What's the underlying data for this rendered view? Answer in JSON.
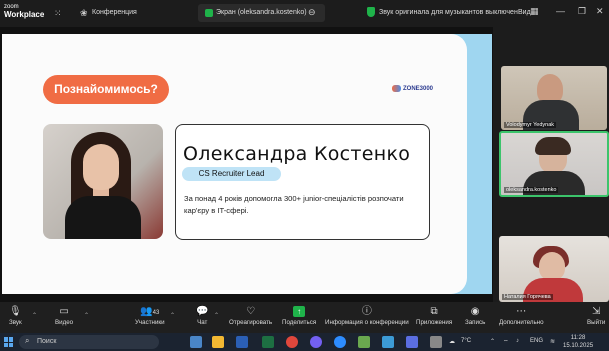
{
  "app": {
    "logo_line1": "zoom",
    "logo_line2": "Workplace"
  },
  "topbar": {
    "conference_label": "Конференция",
    "screen_tab_label": "Экран (oleksandra.kostenko)",
    "notice": "Звук оригинала для музыкантов выключен",
    "view_label": "Вид"
  },
  "slide": {
    "pill": "Познайомимось?",
    "brand": "ZONE3000",
    "name": "Олександра Костенко",
    "role": "CS Recruiter Lead",
    "description": "За понад 4 років допомогла 300+ junior-спеціалістів розпочати кар'єру в IT-сфері."
  },
  "participants": [
    {
      "name": "Volodymyr Yedynak"
    },
    {
      "name": "oleksandra.kostenko"
    },
    {
      "name": "Наталия Горячева"
    }
  ],
  "toolbar": {
    "audio": "Звук",
    "video": "Видео",
    "participants": "Участники",
    "participants_count": "43",
    "chat": "Чат",
    "react": "Отреагировать",
    "share": "Поделиться",
    "info": "Информация о конференции",
    "apps": "Приложения",
    "record": "Запись",
    "more": "Дополнительно",
    "leave": "Выйти"
  },
  "taskbar": {
    "search_placeholder": "Поиск",
    "temperature": "7°C",
    "language": "ENG",
    "time": "11:28",
    "date": "15.10.2025"
  },
  "colors": {
    "accent_orange": "#f06c44",
    "slide_blue": "#a9d7ef",
    "zoom_green": "#1fb34a"
  }
}
